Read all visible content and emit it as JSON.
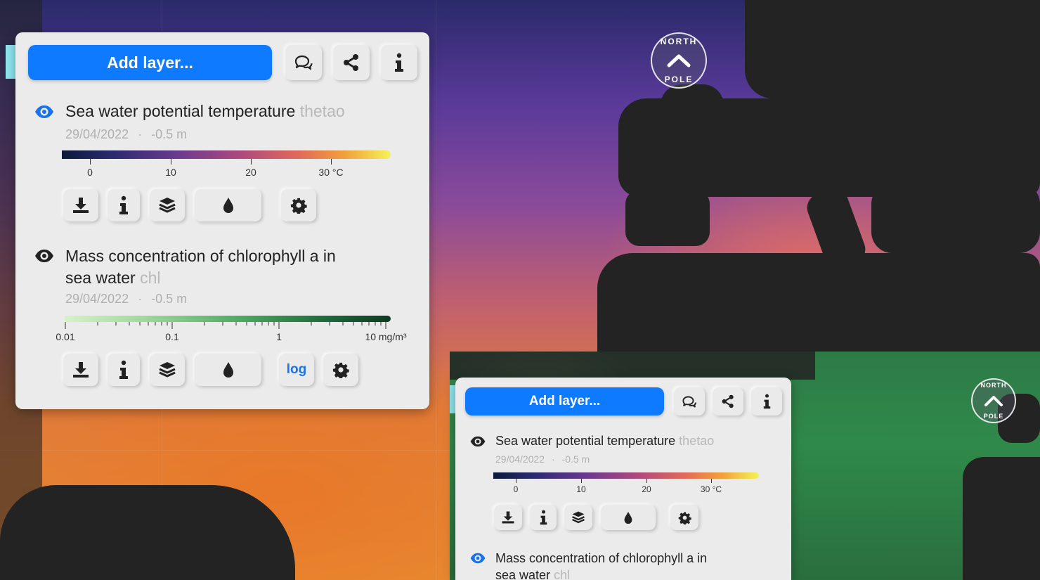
{
  "colors": {
    "accent": "#0d7aff",
    "eye_active": "#1a73e8",
    "log_link": "#1a73e8"
  },
  "main_panel": {
    "add_layer_label": "Add layer...",
    "header_icons": [
      "chat-icon",
      "share-icon",
      "info-icon"
    ],
    "layers": [
      {
        "title": "Sea water potential temperature",
        "var": "thetao",
        "date": "29/04/2022",
        "sep": "·",
        "depth": "-0.5 m",
        "visible_icon": "eye-active-icon",
        "ticks": [
          "0",
          "10",
          "20",
          "30 °C"
        ],
        "tools": [
          "download-icon",
          "info-icon",
          "layers-icon",
          "droplet-icon",
          "gear-icon"
        ]
      },
      {
        "title_line1": "Mass concentration of chlorophyll a in",
        "title_line2": "sea water",
        "var": "chl",
        "date": "29/04/2022",
        "sep": "·",
        "depth": "-0.5 m",
        "visible_icon": "eye-icon",
        "ticks": [
          "0.01",
          "0.1",
          "1",
          "10 mg/m³"
        ],
        "log_label": "log",
        "tools": [
          "download-icon",
          "info-icon",
          "layers-icon",
          "droplet-icon",
          "gear-icon"
        ]
      }
    ]
  },
  "inset_panel": {
    "add_layer_label": "Add layer...",
    "layers": [
      {
        "title": "Sea water potential temperature",
        "var": "thetao",
        "date": "29/04/2022",
        "sep": "·",
        "depth": "-0.5 m",
        "ticks": [
          "0",
          "10",
          "20",
          "30 °C"
        ]
      },
      {
        "title_line1": "Mass concentration of chlorophyll a in",
        "title_line2": "sea water",
        "var": "chl"
      }
    ]
  },
  "compass": {
    "top_text": "NORTH",
    "bottom_text": "POLE"
  }
}
